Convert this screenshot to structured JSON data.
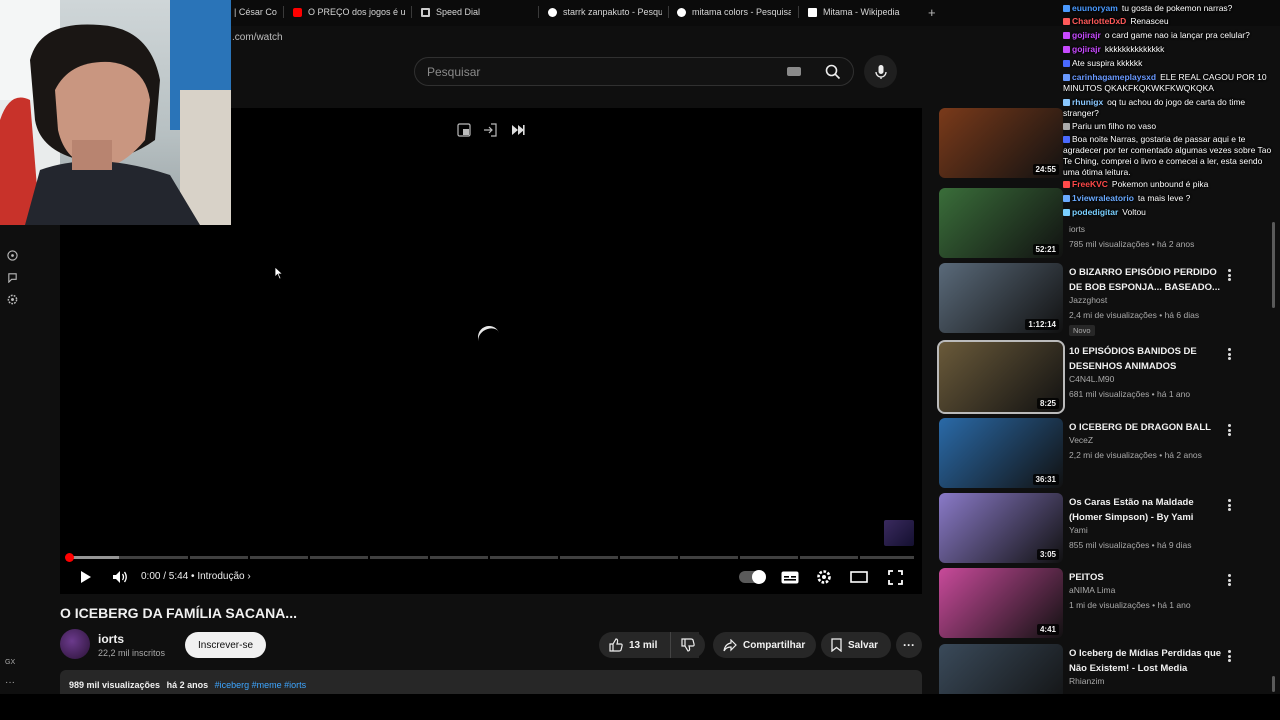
{
  "tabs": [
    {
      "label": "| César Co",
      "favicon_color": "#888888"
    },
    {
      "label": "O PREÇO dos jogos é um",
      "favicon_color": "#ff0000"
    },
    {
      "label": "Speed Dial",
      "favicon_color": "#cccccc"
    },
    {
      "label": "starrk zanpakuto - Pesqu",
      "favicon_color": "#ffffff"
    },
    {
      "label": "mitama colors - Pesquisa",
      "favicon_color": "#ffffff"
    },
    {
      "label": "Mitama - Wikipedia",
      "favicon_color": "#ffffff"
    }
  ],
  "url": ".com/watch",
  "search": {
    "placeholder": "Pesquisar"
  },
  "player": {
    "time": "0:00 / 5:44",
    "chapter": "Introdução",
    "played_fraction": 0.0,
    "buffered_fraction": 0.06
  },
  "video": {
    "title": "O ICEBERG DA FAMÍLIA SACANA...",
    "channel": "iorts",
    "subscribers": "22,2 mil inscritos",
    "subscribe_label": "Inscrever-se",
    "likes": "13 mil",
    "share_label": "Compartilhar",
    "save_label": "Salvar",
    "views": "989 mil visualizações",
    "age": "há 2 anos",
    "tags": "#iceberg #meme #iorts"
  },
  "guide": {
    "label": "GX"
  },
  "recommendations": [
    {
      "title": "",
      "channel": "",
      "meta": "",
      "duration": "24:55",
      "thumb": "#7a3a1a"
    },
    {
      "title": "",
      "channel": "iorts",
      "meta": "785 mil visualizações • há 2 anos",
      "duration": "52:21",
      "thumb": "#3a6e3a"
    },
    {
      "title": "O BIZARRO EPISÓDIO PERDIDO DE BOB ESPONJA... BASEADO...",
      "channel": "Jazzghost",
      "meta": "2,4 mi de visualizações • há 6 dias",
      "badge": "Novo",
      "duration": "1:12:14",
      "thumb": "#5a6a7a"
    },
    {
      "title": "10 EPISÓDIOS BANIDOS DE DESENHOS ANIMADOS",
      "channel": "C4N4L.M90",
      "meta": "681 mil visualizações • há 1 ano",
      "duration": "8:25",
      "thumb": "#6a5a3a"
    },
    {
      "title": "O ICEBERG DE DRAGON BALL",
      "channel": "VeceZ",
      "meta": "2,2 mi de visualizações • há 2 anos",
      "duration": "36:31",
      "thumb": "#2a6aa8"
    },
    {
      "title": "Os Caras Estão na Maldade (Homer Simpson) - By Yami",
      "channel": "Yami",
      "meta": "855 mil visualizações • há 9 dias",
      "duration": "3:05",
      "thumb": "#8a7ac8"
    },
    {
      "title": "PEITOS",
      "channel": "aNIMA Lima",
      "meta": "1 mi de visualizações • há 1 ano",
      "duration": "4:41",
      "thumb": "#c84a9a"
    },
    {
      "title": "O Iceberg de Mídias Perdidas que Não Existem! - Lost Media",
      "channel": "Rhianzim",
      "meta": "",
      "duration": "",
      "thumb": "#3a4a5a"
    }
  ],
  "chat": [
    {
      "user": "euunoryam",
      "color": "#4a9aff",
      "msg": "tu gosta de pokemon narras?"
    },
    {
      "user": "CharlotteDxD",
      "color": "#ff5a5a",
      "msg": "Renasceu"
    },
    {
      "user": "gojirajr",
      "color": "#c84aff",
      "msg": "o card game nao ia lançar pra celular?"
    },
    {
      "user": "gojirajr",
      "color": "#c84aff",
      "msg": "kkkkkkkkkkkkkk"
    },
    {
      "user": "",
      "color": "#4a6aff",
      "msg": "Ate suspira kkkkkk"
    },
    {
      "user": "carinhagameplaysxd",
      "color": "#6a9aff",
      "msg": "ELE REAL CAGOU POR 10 MINUTOS QKAKFKQKWKFKWQKQKA"
    },
    {
      "user": "rhunigx",
      "color": "#8ac8ff",
      "msg": "oq tu achou do jogo de carta do time stranger?"
    },
    {
      "user": "",
      "color": "#aaaaaa",
      "msg": "Pariu um filho no vaso"
    },
    {
      "user": "",
      "color": "#4a6aff",
      "msg": "Boa noite Narras, gostaria de passar aqui e te agradecer por ter comentado algumas vezes sobre Tao Te Ching, comprei o livro e comecei a ler, esta sendo uma ótima leitura."
    },
    {
      "user": "FreeKVC",
      "color": "#ff4a4a",
      "msg": "Pokemon unbound é pika"
    },
    {
      "user": "1viewraleatorio",
      "color": "#6aaaff",
      "msg": "ta mais leve ?"
    },
    {
      "user": "podedigitar",
      "color": "#7ad0ff",
      "msg": "Voltou"
    }
  ]
}
